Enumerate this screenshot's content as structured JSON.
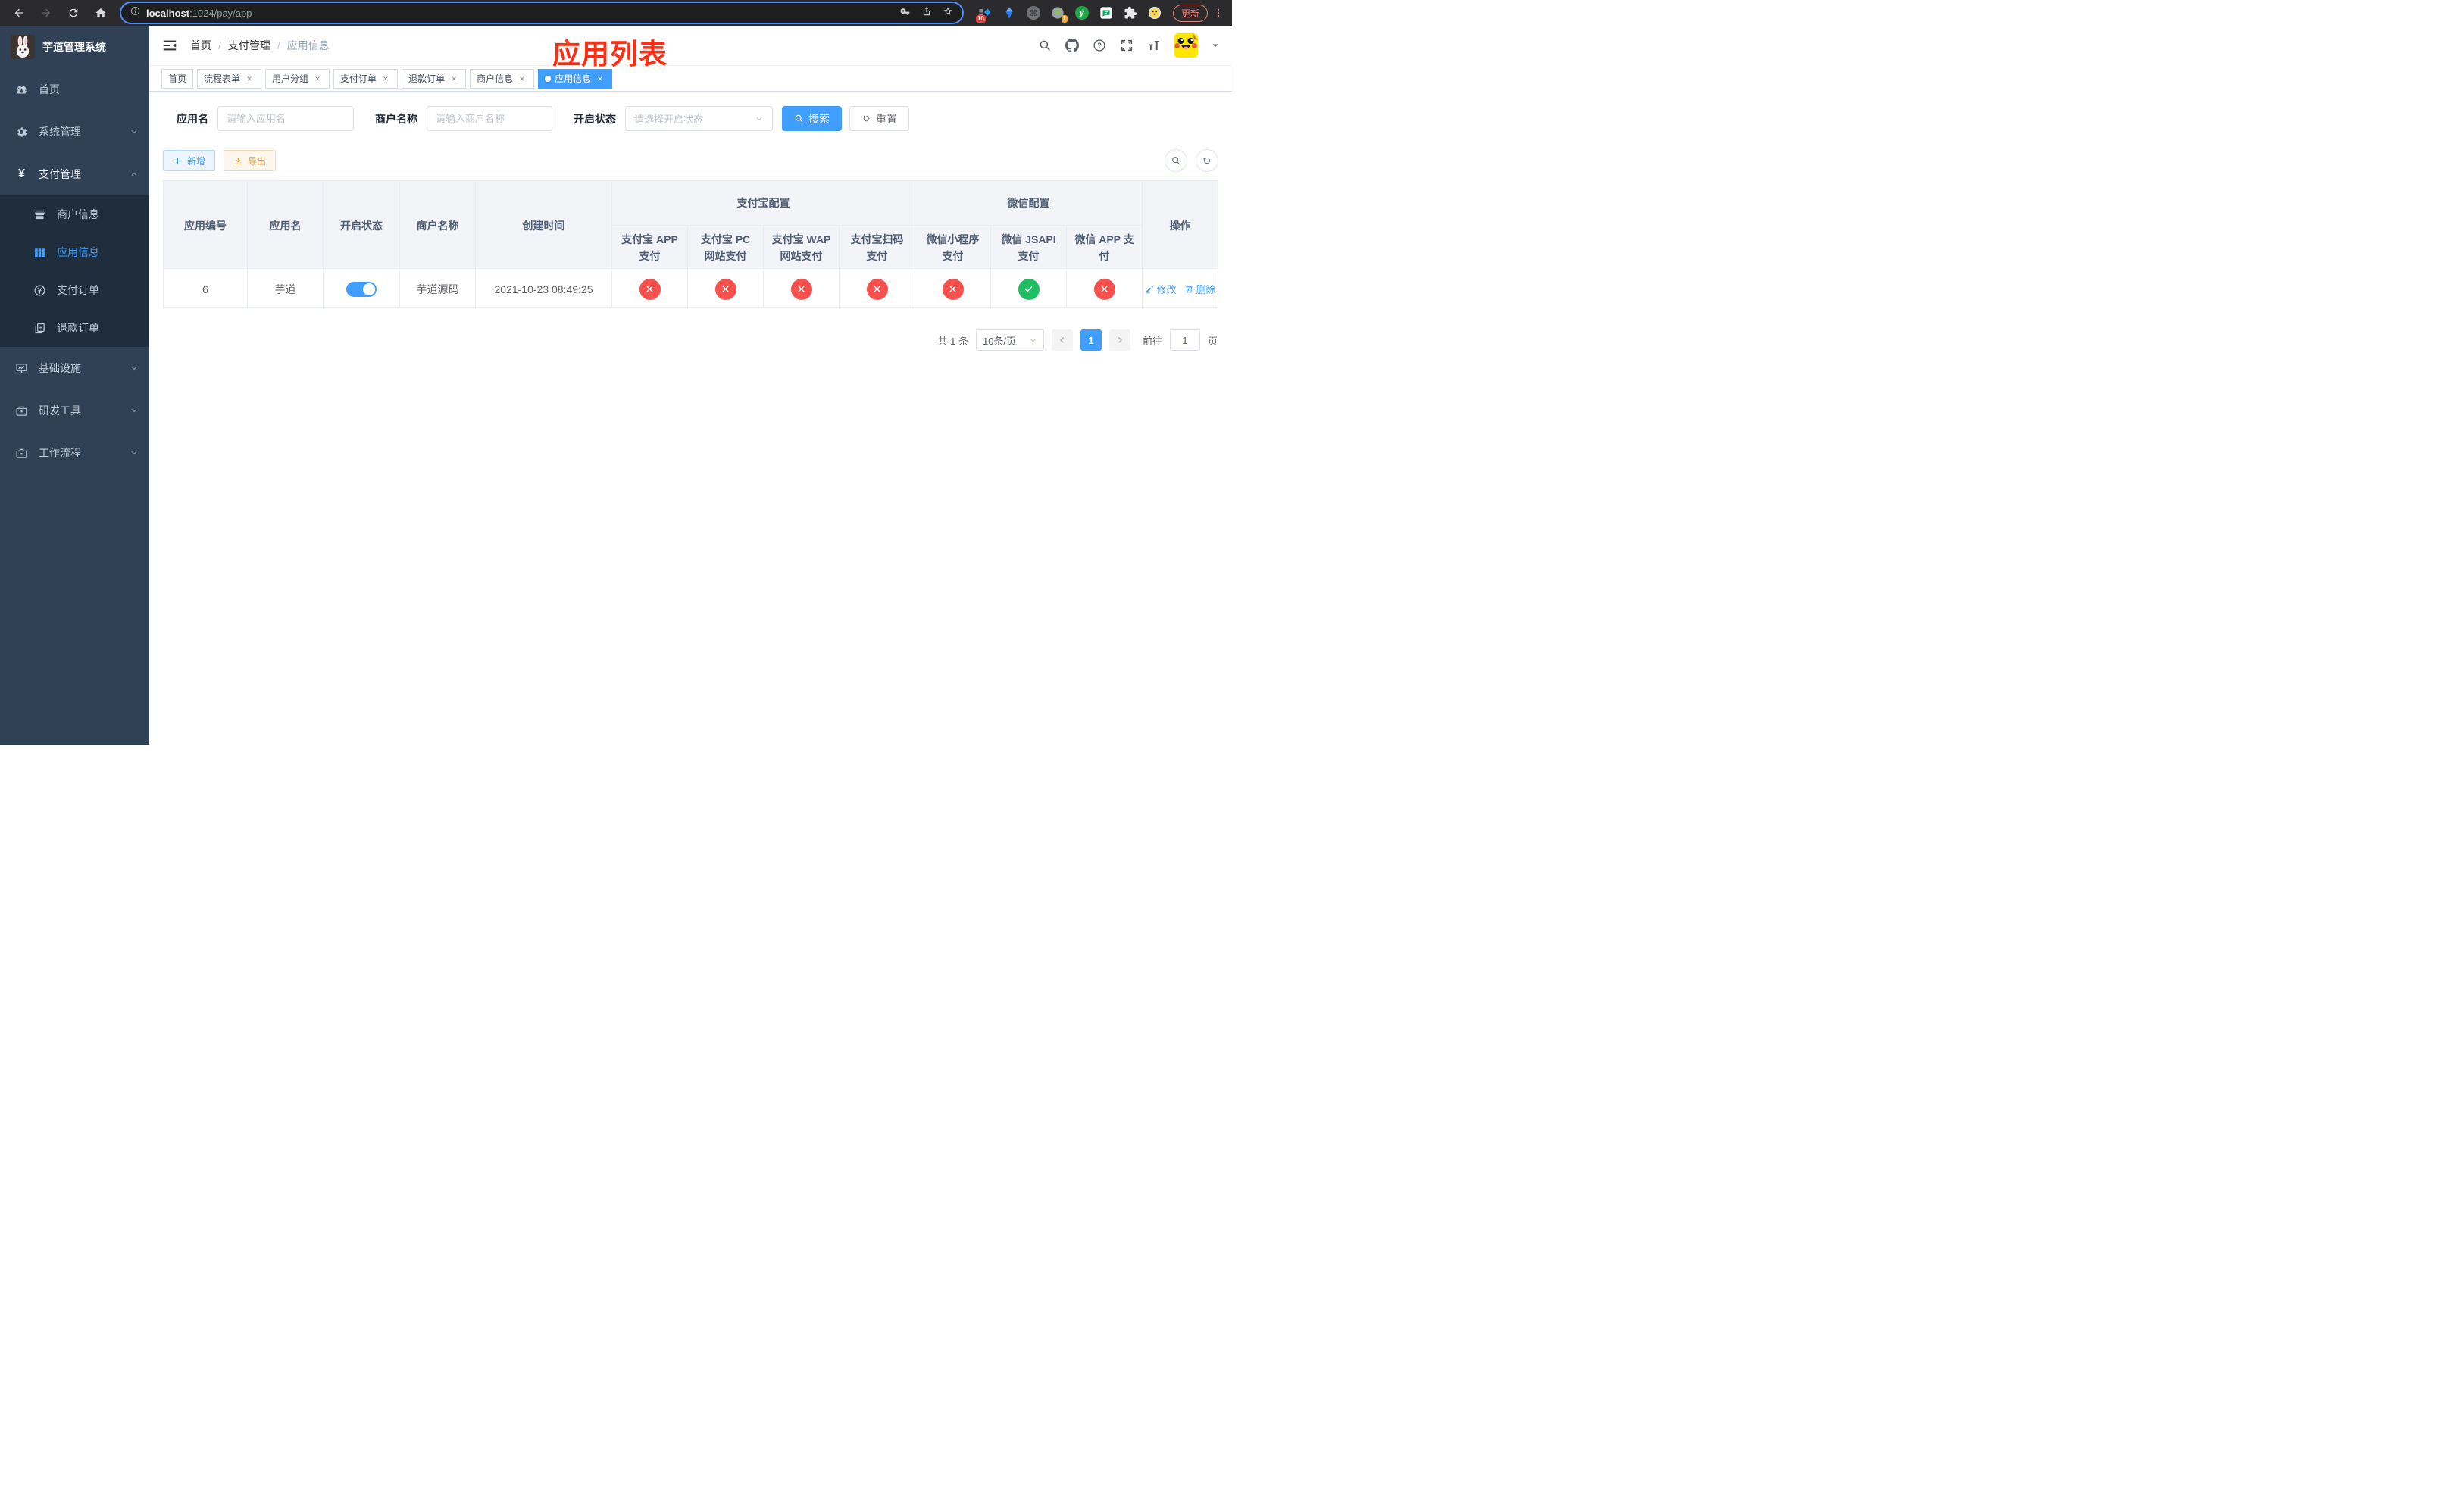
{
  "browser": {
    "url_host": "localhost",
    "url_path": ":1024/pay/app",
    "update_label": "更新",
    "ext_badge_red": "10",
    "ext_badge_orange": "1",
    "cmd_glyph": "⌘",
    "y_glyph": "y"
  },
  "sidebar": {
    "title": "芋道管理系统",
    "menu": [
      {
        "label": "首页",
        "icon": "dashboard-icon"
      },
      {
        "label": "系统管理",
        "icon": "gear-icon"
      },
      {
        "label": "支付管理",
        "icon": "yuan-icon",
        "expanded": true,
        "children": [
          {
            "label": "商户信息",
            "icon": "shop-icon"
          },
          {
            "label": "应用信息",
            "icon": "grid-icon",
            "active": true
          },
          {
            "label": "支付订单",
            "icon": "yuan-circle-icon"
          },
          {
            "label": "退款订单",
            "icon": "document-icon"
          }
        ]
      },
      {
        "label": "基础设施",
        "icon": "monitor-icon"
      },
      {
        "label": "研发工具",
        "icon": "toolbox-icon"
      },
      {
        "label": "工作流程",
        "icon": "toolbox-icon"
      }
    ],
    "yuan_glyph": "¥"
  },
  "navbar": {
    "breadcrumb": [
      "首页",
      "支付管理",
      "应用信息"
    ],
    "separator": "/",
    "question_glyph": "?"
  },
  "overlay": {
    "title": "应用列表"
  },
  "tabs": [
    {
      "label": "首页",
      "closable": false,
      "active": false
    },
    {
      "label": "流程表单",
      "closable": true,
      "active": false
    },
    {
      "label": "用户分组",
      "closable": true,
      "active": false
    },
    {
      "label": "支付订单",
      "closable": true,
      "active": false
    },
    {
      "label": "退款订单",
      "closable": true,
      "active": false
    },
    {
      "label": "商户信息",
      "closable": true,
      "active": false
    },
    {
      "label": "应用信息",
      "closable": true,
      "active": true
    }
  ],
  "tab_close_glyph": "×",
  "filters": {
    "app_name": {
      "label": "应用名",
      "placeholder": "请输入应用名",
      "value": ""
    },
    "merchant_name": {
      "label": "商户名称",
      "placeholder": "请输入商户名称",
      "value": ""
    },
    "status": {
      "label": "开启状态",
      "placeholder": "请选择开启状态",
      "value": ""
    },
    "search_label": "搜索",
    "reset_label": "重置"
  },
  "toolbar": {
    "add_label": "新增",
    "export_label": "导出"
  },
  "table": {
    "headers": {
      "app_id": "应用编号",
      "app_name": "应用名",
      "status": "开启状态",
      "merchant": "商户名称",
      "created": "创建时间",
      "group_alipay": "支付宝配置",
      "group_wechat": "微信配置",
      "alipay_app": "支付宝 APP 支付",
      "alipay_pc": "支付宝 PC 网站支付",
      "alipay_wap": "支付宝 WAP 网站支付",
      "alipay_qr": "支付宝扫码支付",
      "wx_mini": "微信小程序支付",
      "wx_jsapi": "微信 JSAPI 支付",
      "wx_app": "微信 APP 支付",
      "actions": "操作"
    },
    "rows": [
      {
        "app_id": "6",
        "app_name": "芋道",
        "status_on": true,
        "merchant": "芋道源码",
        "created": "2021-10-23 08:49:25",
        "alipay_app": "disabled",
        "alipay_pc": "disabled",
        "alipay_wap": "disabled",
        "alipay_qr": "disabled",
        "wx_mini": "disabled",
        "wx_jsapi": "enabled",
        "wx_app": "disabled",
        "edit_label": "修改",
        "delete_label": "删除"
      }
    ]
  },
  "pagination": {
    "total_text": "共 1 条",
    "page_size": "10条/页",
    "current_page": "1",
    "goto_label": "前往",
    "goto_value": "1",
    "page_unit": "页"
  },
  "colors": {
    "accent": "#409eff",
    "success": "#1fbe62",
    "danger": "#f8504c",
    "warning": "#e6a23c",
    "sidebar_bg": "#304156",
    "submenu_bg": "#1f2d3d",
    "overlay_red": "#ff2d12",
    "chrome_update": "#f28b82"
  }
}
